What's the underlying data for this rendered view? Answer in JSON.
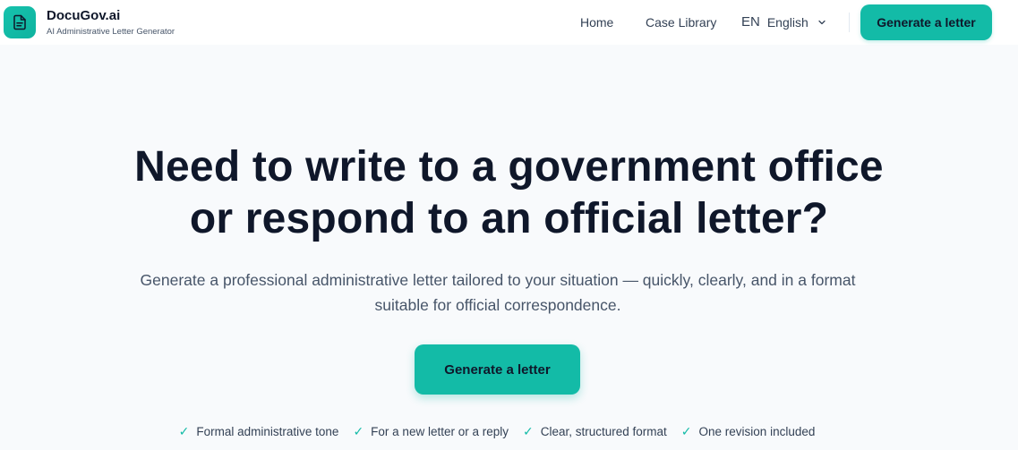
{
  "brand": {
    "name": "DocuGov.ai",
    "tagline": "AI Administrative Letter Generator",
    "logo_icon": "document-icon"
  },
  "nav": {
    "home": "Home",
    "case_library": "Case Library",
    "lang_code": "EN",
    "lang_label": "English",
    "cta": "Generate a letter"
  },
  "hero": {
    "title_line1": "Need to write to a government office",
    "title_line2": "or respond to an official letter?",
    "subtitle": "Generate a professional administrative letter tailored to your situation — quickly, clearly, and in a format suitable for official correspondence.",
    "cta": "Generate a letter"
  },
  "features": [
    {
      "check": "✓",
      "label": "Formal administrative tone"
    },
    {
      "check": "✓",
      "label": "For a new letter or a reply"
    },
    {
      "check": "✓",
      "label": "Clear, structured format"
    },
    {
      "check": "✓",
      "label": "One revision included"
    }
  ],
  "colors": {
    "accent": "#13bba7",
    "text": "#0f172a",
    "muted": "#475569",
    "background": "#f8fafc"
  }
}
